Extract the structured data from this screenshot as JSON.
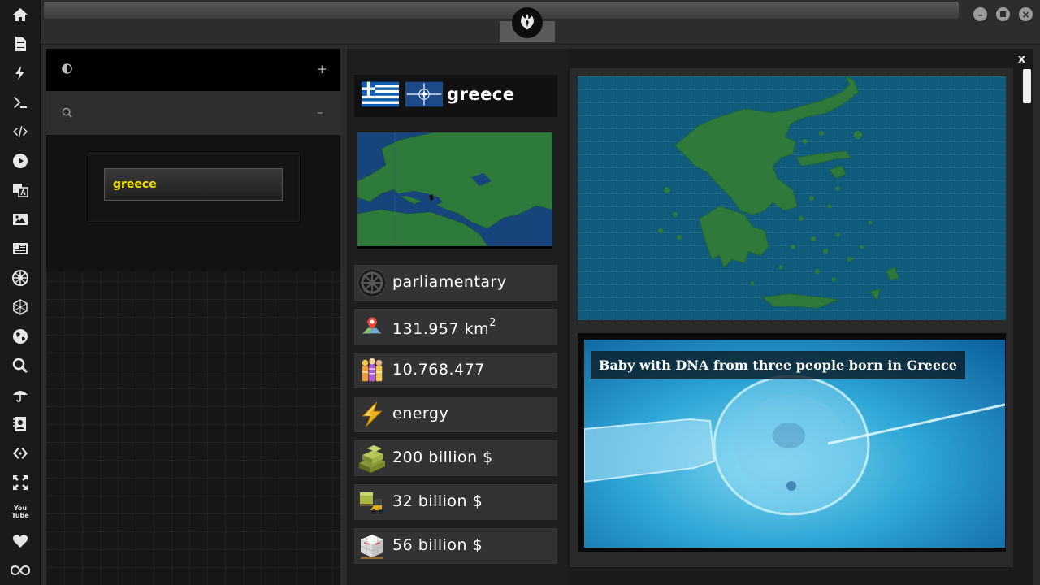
{
  "sidebar": {
    "icons": [
      "home-icon",
      "document-icon",
      "lightning-icon",
      "terminal-icon",
      "code-icon",
      "play-icon",
      "translate-icon",
      "image-icon",
      "newspaper-icon",
      "galactic-empire-icon",
      "hexagon-icon",
      "globe-icon",
      "search-icon",
      "umbrella-icon",
      "contacts-icon",
      "diamond-code-icon",
      "expand-icon",
      "youtube-icon",
      "heart-icon",
      "infinity-icon"
    ],
    "youtube_label": "You Tube"
  },
  "left_panel": {
    "search_value": "greece",
    "plus_label": "+",
    "minus_label": "–"
  },
  "right_panel": {
    "close_label": "x",
    "country": {
      "name": "greece",
      "flags": [
        "greece-flag",
        "nato-flag"
      ]
    },
    "facts": [
      {
        "icon": "galactic-empire-icon",
        "text": "parliamentary"
      },
      {
        "icon": "map-pin-icon",
        "text": "131.957 km",
        "sup": "2"
      },
      {
        "icon": "population-icon",
        "text": "10.768.477"
      },
      {
        "icon": "energy-icon",
        "text": "energy"
      },
      {
        "icon": "money-stack-icon",
        "text": "200 billion $"
      },
      {
        "icon": "forklift-icon",
        "text": "32 billion $"
      },
      {
        "icon": "boxes-icon",
        "text": "56 billion $"
      }
    ],
    "news": {
      "title": "Baby with DNA from three people born in Greece"
    }
  },
  "colors": {
    "accent_yellow": "#f2e200",
    "map_sea": "#0f5b7c",
    "map_land": "#2f7a3b"
  }
}
